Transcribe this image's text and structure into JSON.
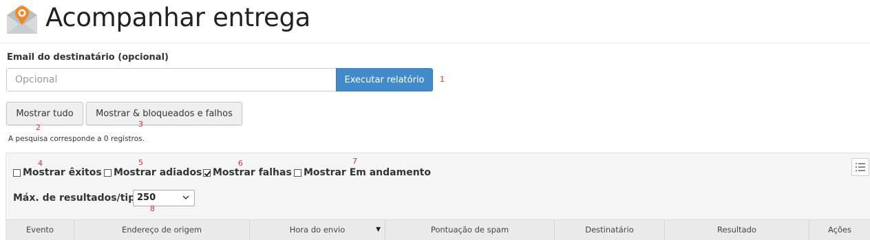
{
  "header": {
    "title": "Acompanhar entrega",
    "icon": "mail-location-pin-icon"
  },
  "form": {
    "email_label": "Email do destinatário (opcional)",
    "email_placeholder": "Opcional",
    "email_value": "",
    "run_button": "Executar relatório"
  },
  "buttons": {
    "show_all": "Mostrar tudo",
    "show_blocked_failed": "Mostrar & bloqueados e falhos"
  },
  "summary": "A pesquisa corresponde a 0 registros.",
  "filters": [
    {
      "label": "Mostrar êxitos",
      "checked": false
    },
    {
      "label": "Mostrar adiados",
      "checked": false
    },
    {
      "label": "Mostrar falhas",
      "checked": true
    },
    {
      "label": "Mostrar Em andamento",
      "checked": false
    }
  ],
  "max_results": {
    "label": "Máx. de resultados/tipo:",
    "value": "250"
  },
  "table": {
    "columns": [
      "Evento",
      "Endereço de origem",
      "Hora do envio",
      "Pontuação de spam",
      "Destinatário",
      "Resultado",
      "Ações"
    ],
    "sorted_column": "Hora do envio"
  },
  "markers": [
    "1",
    "2",
    "3",
    "4",
    "5",
    "6",
    "7",
    "8"
  ],
  "colors": {
    "primary": "#428bca",
    "marker": "#d9312a",
    "icon_orange": "#f08a24"
  }
}
